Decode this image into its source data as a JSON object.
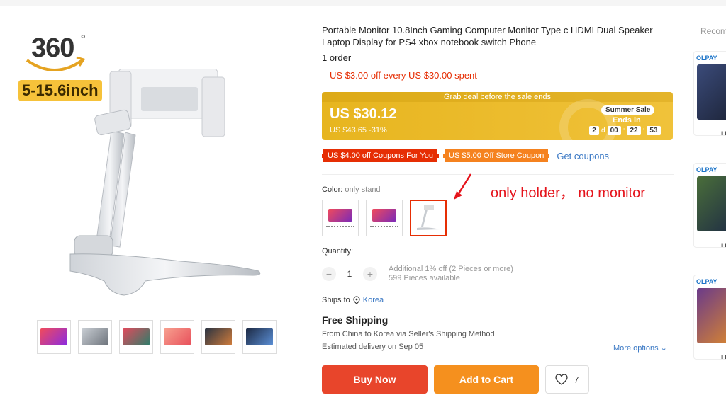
{
  "gallery": {
    "badge_number": "360",
    "badge_degree": "°",
    "size_badge": "5-15.6inch",
    "thumbs": [
      {
        "name": "thumb-1",
        "color": "#d23b57"
      },
      {
        "name": "thumb-2",
        "color": "#b0b7bf"
      },
      {
        "name": "thumb-3",
        "color": "#2e7d6a"
      },
      {
        "name": "thumb-4",
        "color": "#f07c6e"
      },
      {
        "name": "thumb-5",
        "color": "#4d5a6d"
      },
      {
        "name": "thumb-6",
        "color": "#3d6aa8"
      }
    ]
  },
  "product": {
    "title": "Portable Monitor 10.8Inch Gaming Computer Monitor Type c HDMI Dual Speaker Laptop Display for PS4 xbox notebook switch Phone",
    "orders": "1 order",
    "promo": "US $3.00 off every US $30.00 spent"
  },
  "deal": {
    "grab": "Grab deal before the sale ends",
    "price": "US $30.12",
    "old_price": "US $43.65",
    "discount": "-31%",
    "summer": "Summer Sale",
    "ends_in": "Ends in",
    "days": "2",
    "day_unit": "d",
    "hours": "00",
    "minutes": "22",
    "seconds": "53"
  },
  "coupons": {
    "c1": "US $4.00 off Coupons For You",
    "c2": "US $5.00 Off Store Coupon",
    "get": "Get coupons"
  },
  "color": {
    "label": "Color:",
    "value": "only stand",
    "annotation": "only holder，  no monitor"
  },
  "quantity": {
    "label": "Quantity:",
    "value": "1",
    "minus": "−",
    "plus": "+",
    "info1": "Additional 1% off (2 Pieces or more)",
    "info2": "599 Pieces available"
  },
  "shipping": {
    "ships_to": "Ships to",
    "country": "Korea",
    "free": "Free Shipping",
    "from_text": "From China to Korea via Seller's Shipping Method",
    "est": "Estimated delivery on Sep 05",
    "more": "More options"
  },
  "actions": {
    "buy": "Buy Now",
    "cart": "Add to Cart",
    "wish_count": "7"
  },
  "recs": {
    "title": "Recom",
    "items": [
      {
        "brand": "OLPAY",
        "price": "US"
      },
      {
        "brand": "OLPAY",
        "price": "US"
      },
      {
        "brand": "OLPAY",
        "price": "US"
      }
    ]
  }
}
